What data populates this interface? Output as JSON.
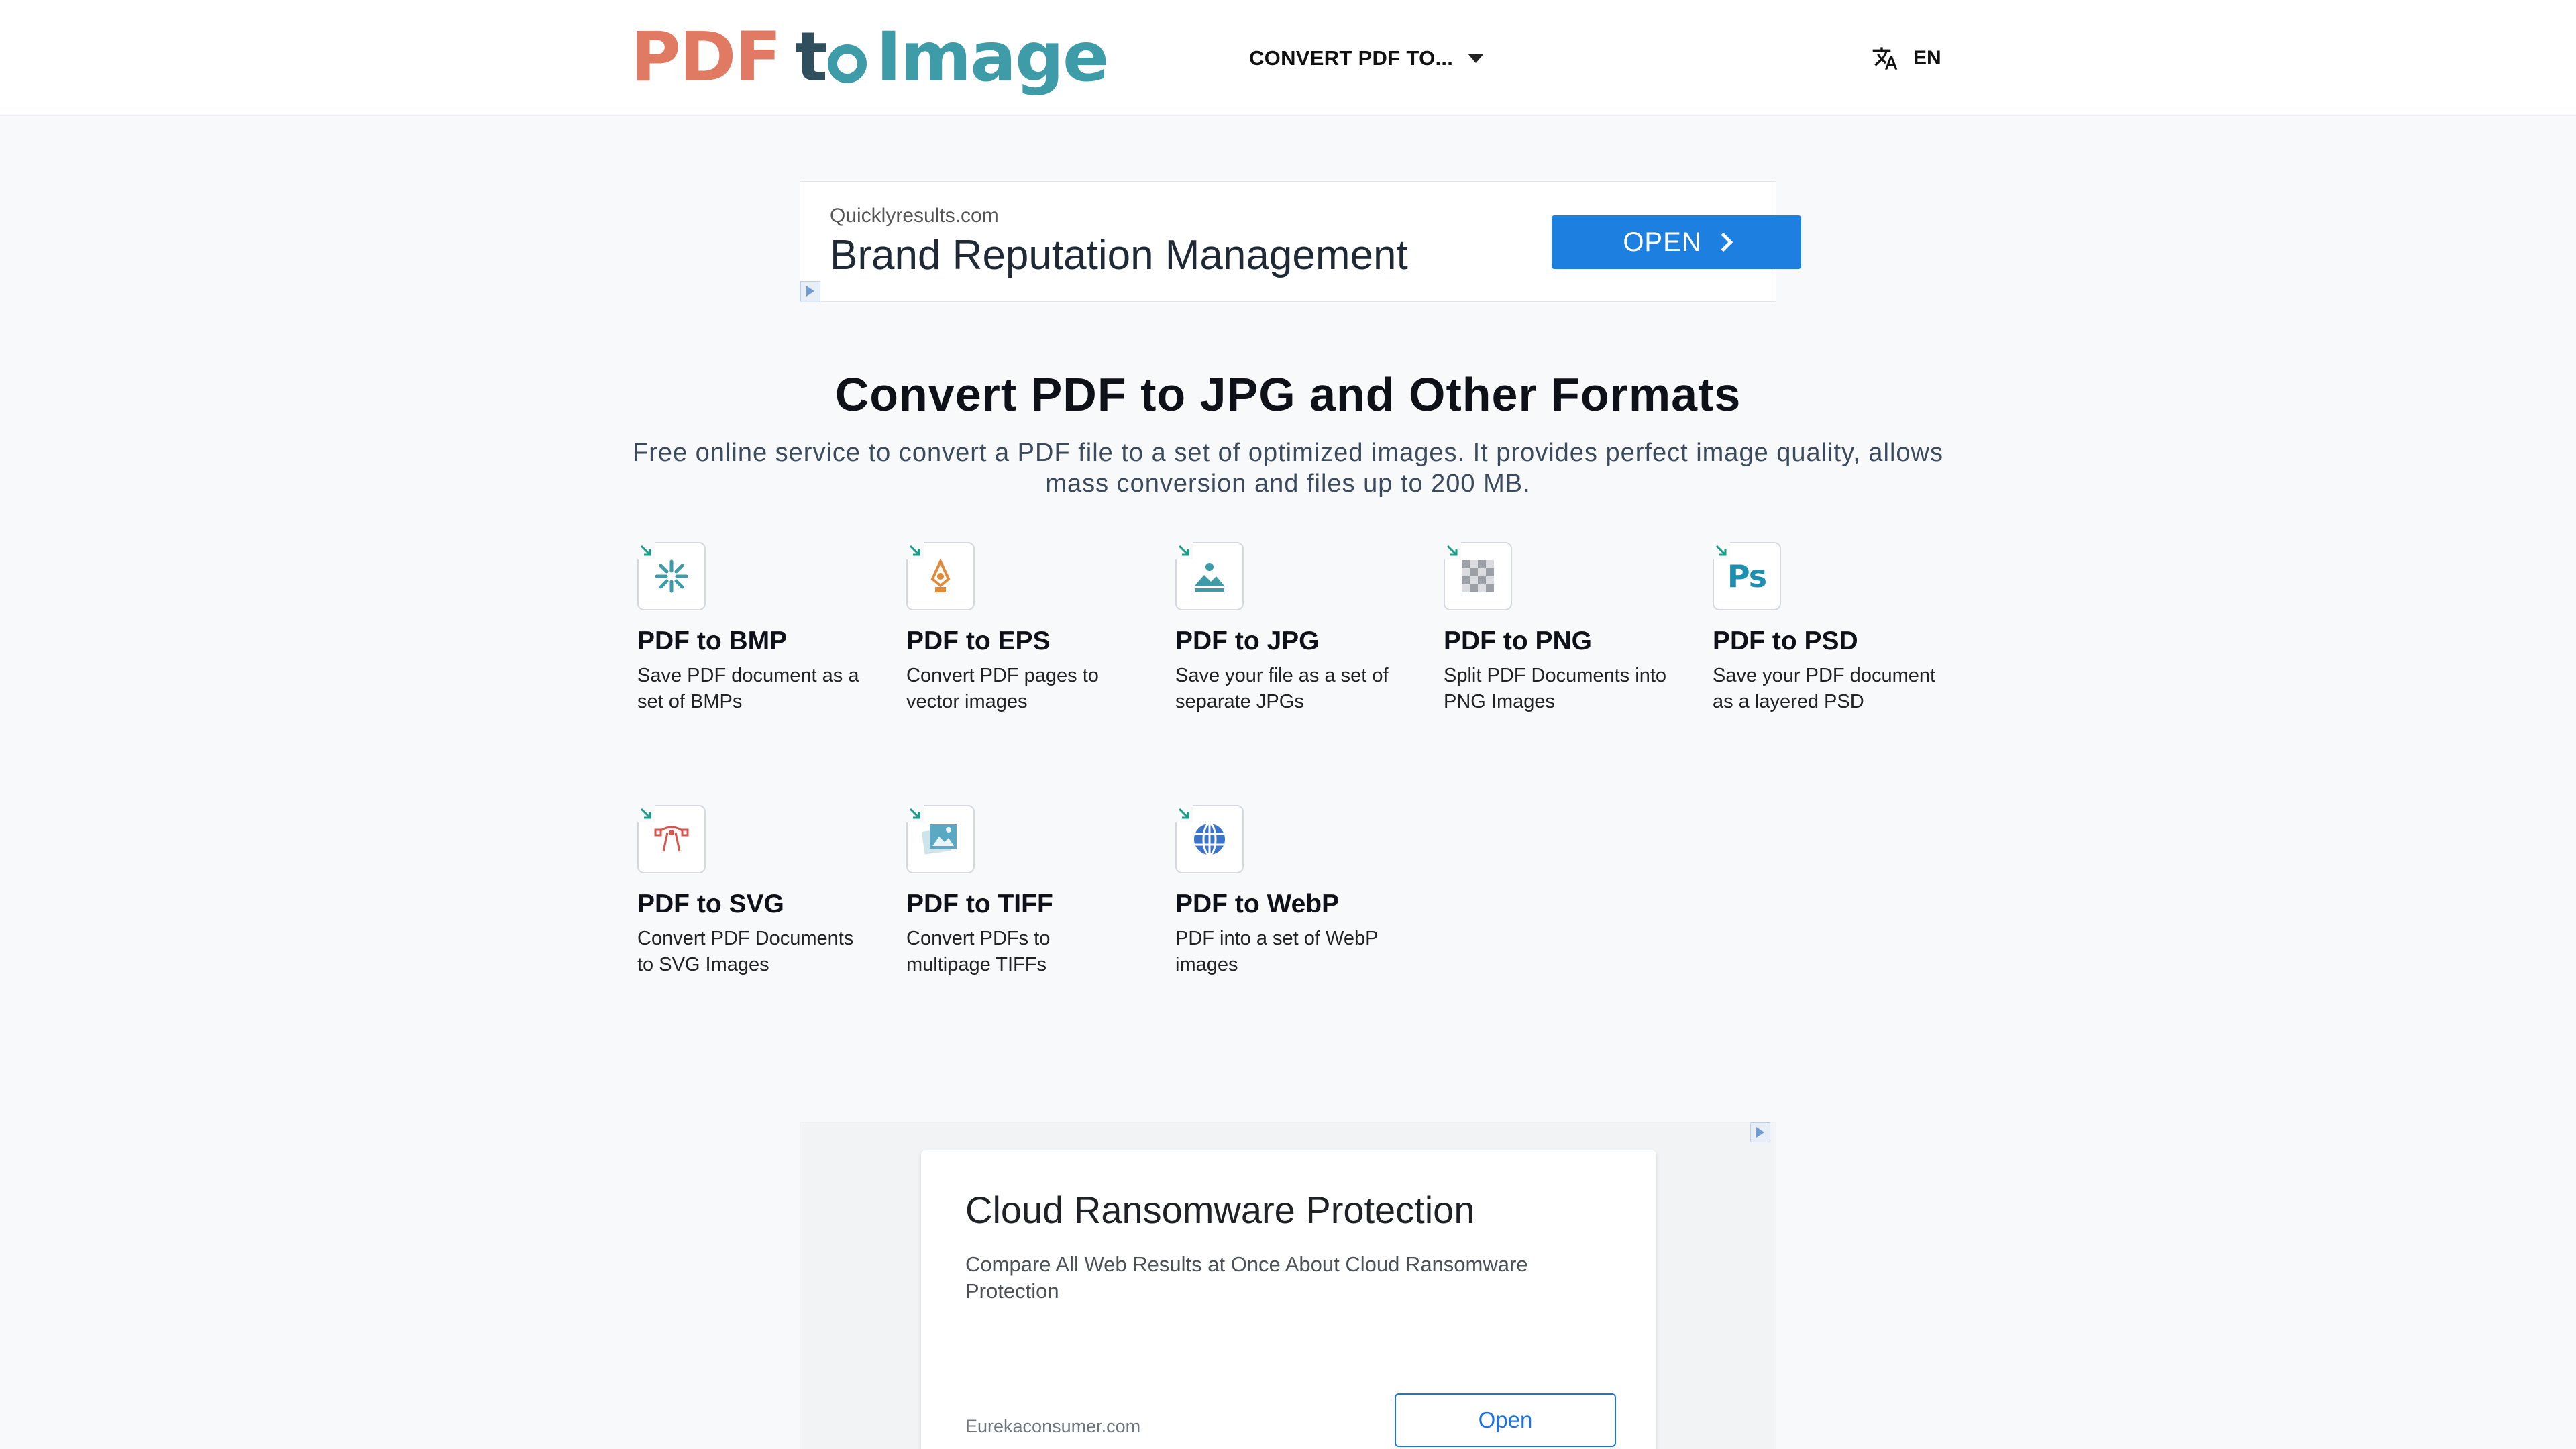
{
  "header": {
    "logo": {
      "part1": "PDF",
      "part2": "t",
      "part3": "Image"
    },
    "nav_convert": "CONVERT PDF TO...",
    "lang_icon": "translate-icon",
    "lang": "EN"
  },
  "ad1": {
    "domain": "Quicklyresults.com",
    "title": "Brand Reputation Management",
    "button": "OPEN"
  },
  "hero": {
    "title": "Convert PDF to JPG and Other Formats",
    "subtitle": "Free online service to convert a PDF file to a set of optimized images. It provides perfect image quality, allows mass conversion and files up to 200 MB."
  },
  "converters": [
    {
      "title": "PDF to BMP",
      "desc": "Save PDF document as a set of BMPs",
      "icon": "bmp-format-icon"
    },
    {
      "title": "PDF to EPS",
      "desc": "Convert PDF pages to vector images",
      "icon": "eps-format-icon"
    },
    {
      "title": "PDF to JPG",
      "desc": "Save your file as a set of separate JPGs",
      "icon": "jpg-format-icon"
    },
    {
      "title": "PDF to PNG",
      "desc": "Split PDF Documents into PNG Images",
      "icon": "png-format-icon"
    },
    {
      "title": "PDF to PSD",
      "desc": "Save your PDF document as a layered PSD",
      "icon": "psd-format-icon",
      "icon_text": "Ps"
    },
    {
      "title": "PDF to SVG",
      "desc": "Convert PDF Documents to SVG Images",
      "icon": "svg-format-icon"
    },
    {
      "title": "PDF to TIFF",
      "desc": "Convert PDFs to multipage TIFFs",
      "icon": "tiff-format-icon"
    },
    {
      "title": "PDF to WebP",
      "desc": "PDF into a set of WebP images",
      "icon": "webp-format-icon"
    }
  ],
  "ad2": {
    "title": "Cloud Ransomware Protection",
    "desc": "Compare All Web Results at Once About Cloud Ransomware Protection",
    "domain": "Eurekaconsumer.com",
    "button": "Open"
  },
  "colors": {
    "logo_pdf": "#e07a62",
    "logo_to": "#2f4f5d",
    "logo_image": "#3d9ca8",
    "ad_button": "#1d7fe0",
    "corner_arrow": "#16a085"
  }
}
